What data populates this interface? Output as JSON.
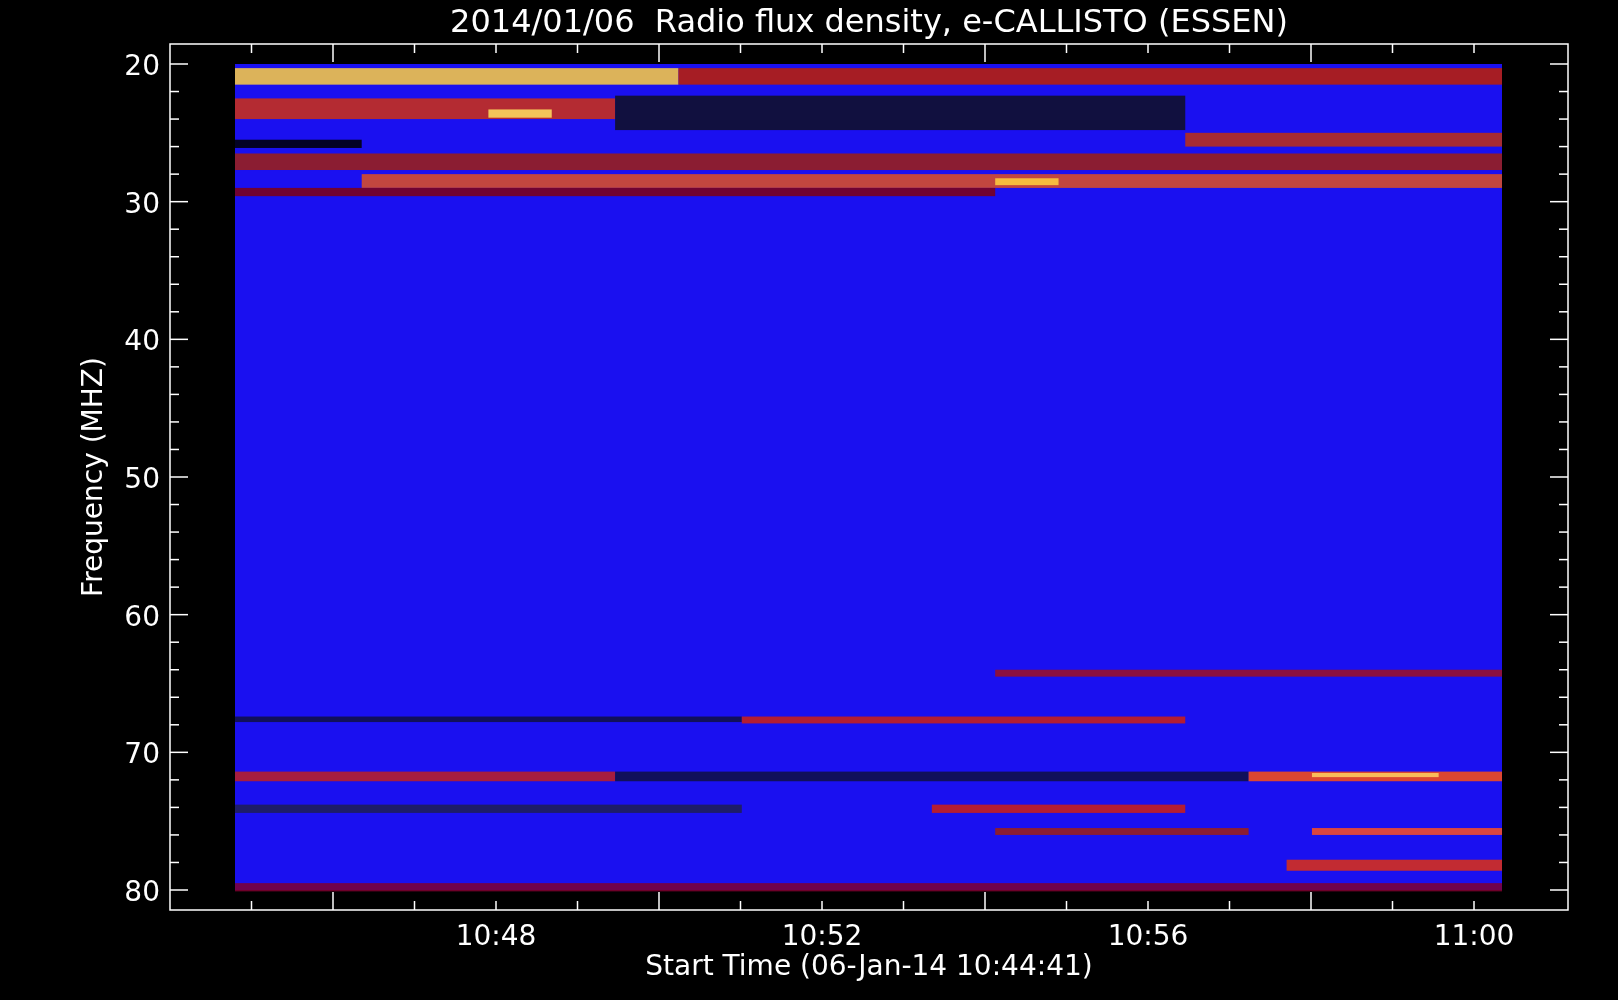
{
  "title": "2014/01/06  Radio flux density, e-CALLISTO (ESSEN)",
  "y_axis": {
    "label": "Frequency (MHZ)",
    "ticks": [
      "20",
      "30",
      "40",
      "50",
      "60",
      "70",
      "80"
    ]
  },
  "x_axis": {
    "label": "Start Time (06-Jan-14 10:44:41)",
    "ticks": [
      "10:48",
      "10:52",
      "10:56",
      "11:00"
    ]
  }
}
